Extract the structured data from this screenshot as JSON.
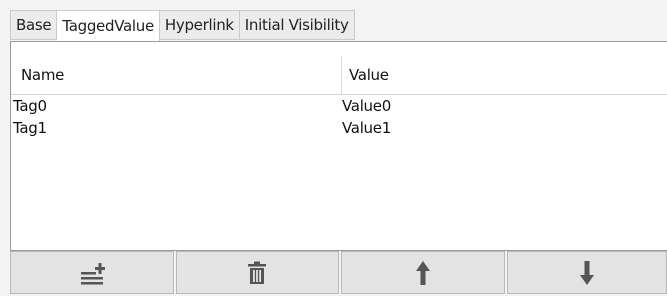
{
  "tabs": [
    "Base",
    "TaggedValue",
    "Hyperlink",
    "Initial Visibility"
  ],
  "active_tab": "TaggedValue",
  "table": {
    "columns": [
      "Name",
      "Value"
    ],
    "rows": [
      {
        "name": "Tag0",
        "value": "Value0"
      },
      {
        "name": "Tag1",
        "value": "Value1"
      }
    ]
  },
  "toolbar": {
    "buttons": [
      {
        "icon": "add-row-icon"
      },
      {
        "icon": "trash-icon"
      },
      {
        "icon": "arrow-up-icon"
      },
      {
        "icon": "arrow-down-icon"
      }
    ]
  },
  "colors": {
    "icon": "#555555",
    "background": "#f3f3f3",
    "button": "#e3e3e3"
  }
}
